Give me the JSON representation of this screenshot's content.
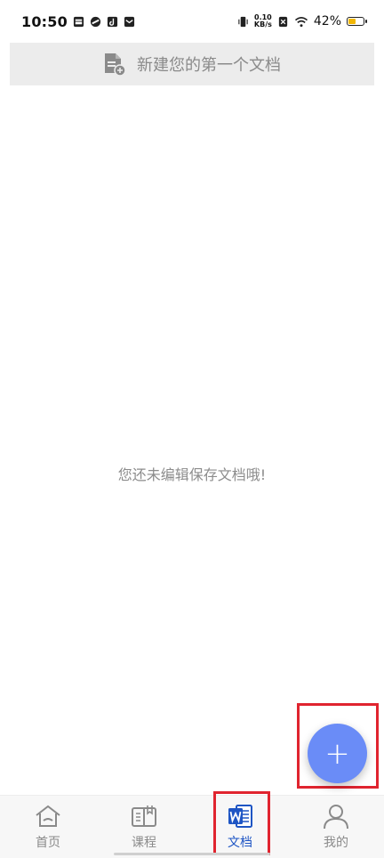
{
  "status_bar": {
    "time": "10:50",
    "net_speed_value": "0.10",
    "net_speed_unit": "KB/s",
    "battery": "42%",
    "battery_color": "#f2b705"
  },
  "banner": {
    "label": "新建您的第一个文档",
    "icon": "new-document-icon"
  },
  "empty_state": {
    "message": "您还未编辑保存文档哦!"
  },
  "fab": {
    "label": "+",
    "color": "#6a8cf7"
  },
  "nav": {
    "items": [
      {
        "label": "首页",
        "icon": "home-icon"
      },
      {
        "label": "课程",
        "icon": "book-icon"
      },
      {
        "label": "文档",
        "icon": "word-document-icon"
      },
      {
        "label": "我的",
        "icon": "user-icon"
      }
    ],
    "active_color": "#1e55c4"
  }
}
